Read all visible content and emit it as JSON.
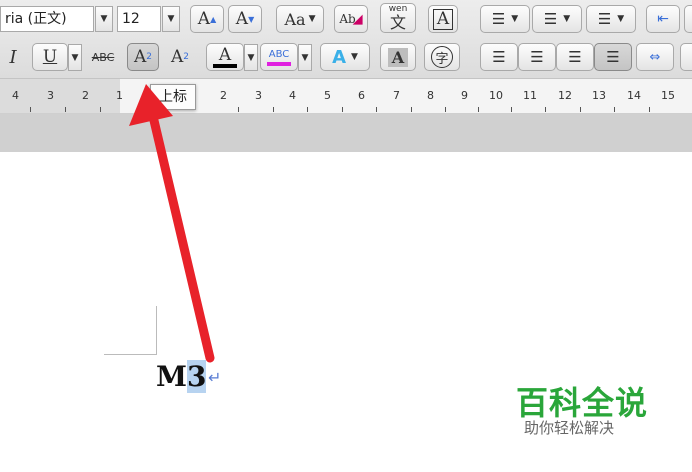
{
  "toolbar": {
    "font_name": "ria (正文)",
    "font_size": "12",
    "grow_label": "A",
    "shrink_label": "A",
    "case_label": "Aa",
    "clear_label": "Ab",
    "phonetic_top": "wen",
    "phonetic_char": "文",
    "border_char_label": "A",
    "italic_label": "I",
    "underline_label": "U",
    "strike_label": "ABC",
    "superscript_label": "A",
    "superscript_sup": "2",
    "subscript_label": "A",
    "subscript_sub": "2",
    "font_color_label": "A",
    "highlight_label": "ABC",
    "effects_label": "A",
    "shade_label": "A",
    "enclose_char": "字",
    "colors": {
      "font_color_bar": "#000000",
      "highlight_bar": "#e020e0",
      "effects": "#3ab0e8"
    }
  },
  "ruler": {
    "ticks": [
      "4",
      "3",
      "2",
      "1",
      "2",
      "3",
      "4",
      "5",
      "6",
      "7",
      "8",
      "9",
      "10",
      "11",
      "12",
      "13",
      "14",
      "15"
    ]
  },
  "tooltip": {
    "text": "上标"
  },
  "document": {
    "text_main": "M",
    "text_selected": "3",
    "return_mark": "↵"
  },
  "watermark": {
    "title": "百科全说",
    "subtitle": "助你轻松解决"
  },
  "annotation": {
    "arrow_color": "#e8222a"
  }
}
